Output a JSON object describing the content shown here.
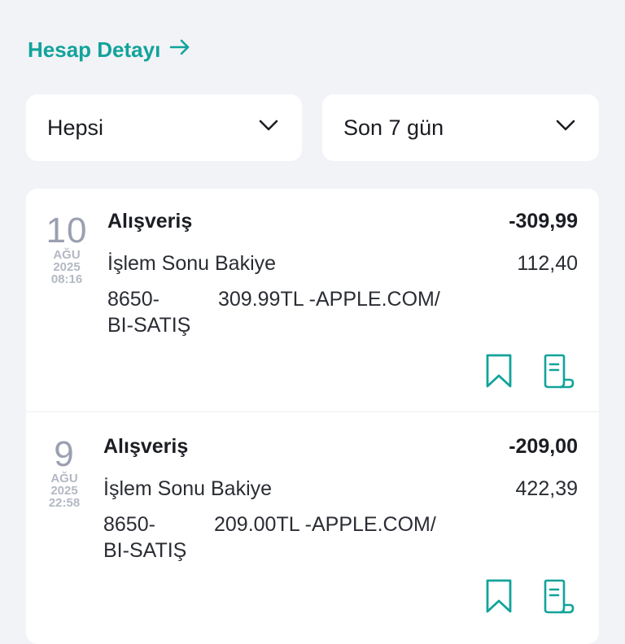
{
  "header": {
    "account_link_label": "Hesap Detayı"
  },
  "filters": {
    "type_value": "Hepsi",
    "period_value": "Son 7 gün"
  },
  "colors": {
    "accent": "#12a39a",
    "background": "#f1f3f7",
    "card": "#ffffff"
  },
  "icons": {
    "link_arrow": "arrow-right-icon",
    "dropdown": "chevron-down-icon",
    "bookmark": "bookmark-icon",
    "receipt": "receipt-icon"
  },
  "transactions": [
    {
      "day": "10",
      "month": "AĞU",
      "year": "2025",
      "time": "08:16",
      "title": "Alışveriş",
      "amount": "-309,99",
      "balance_label": "İşlem Sonu Bakiye",
      "balance_value": "112,40",
      "code": "8650-",
      "description": "309.99TL -APPLE.COM/",
      "description_line2": "BI-SATIŞ"
    },
    {
      "day": "9",
      "month": "AĞU",
      "year": "2025",
      "time": "22:58",
      "title": "Alışveriş",
      "amount": "-209,00",
      "balance_label": "İşlem Sonu Bakiye",
      "balance_value": "422,39",
      "code": "8650-",
      "description": "209.00TL -APPLE.COM/",
      "description_line2": "BI-SATIŞ"
    }
  ]
}
